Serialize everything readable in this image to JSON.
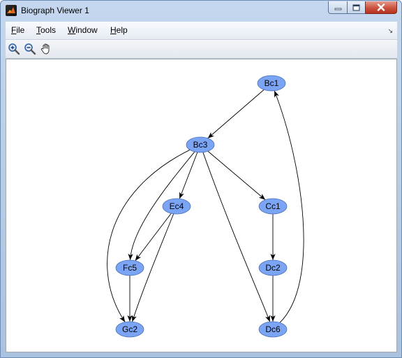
{
  "window": {
    "title": "Biograph Viewer 1",
    "controls": {
      "minimize_icon": "minimize-icon",
      "maximize_icon": "maximize-icon",
      "close_icon": "close-icon"
    }
  },
  "menu": {
    "items": [
      {
        "label": "File",
        "mnemonic": "F",
        "rest": "ile"
      },
      {
        "label": "Tools",
        "mnemonic": "T",
        "rest": "ools"
      },
      {
        "label": "Window",
        "mnemonic": "W",
        "rest": "indow"
      },
      {
        "label": "Help",
        "mnemonic": "H",
        "rest": "elp"
      }
    ]
  },
  "toolbar": {
    "tools": [
      {
        "icon": "zoom-in-icon"
      },
      {
        "icon": "zoom-out-icon"
      },
      {
        "icon": "pan-hand-icon"
      }
    ]
  },
  "graph": {
    "node_fill": "#7ba5f4",
    "nodes": [
      {
        "id": "Bc1"
      },
      {
        "id": "Bc3"
      },
      {
        "id": "Ec4"
      },
      {
        "id": "Cc1"
      },
      {
        "id": "Fc5"
      },
      {
        "id": "Dc2"
      },
      {
        "id": "Gc2"
      },
      {
        "id": "Dc6"
      }
    ],
    "edges": [
      {
        "from": "Bc1",
        "to": "Bc3"
      },
      {
        "from": "Bc3",
        "to": "Ec4"
      },
      {
        "from": "Bc3",
        "to": "Cc1"
      },
      {
        "from": "Bc3",
        "to": "Fc5"
      },
      {
        "from": "Bc3",
        "to": "Gc2"
      },
      {
        "from": "Bc3",
        "to": "Dc6"
      },
      {
        "from": "Ec4",
        "to": "Fc5"
      },
      {
        "from": "Ec4",
        "to": "Gc2"
      },
      {
        "from": "Cc1",
        "to": "Dc2"
      },
      {
        "from": "Fc5",
        "to": "Gc2"
      },
      {
        "from": "Dc2",
        "to": "Dc6"
      },
      {
        "from": "Dc6",
        "to": "Bc1"
      }
    ]
  }
}
